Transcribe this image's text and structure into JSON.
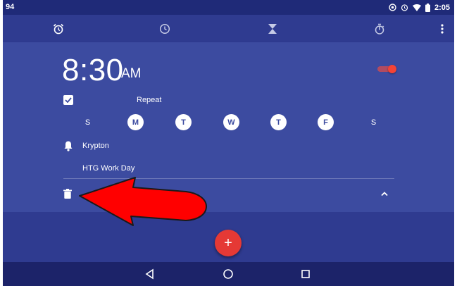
{
  "status_bar": {
    "battery_level": "94",
    "time": "2:05"
  },
  "tabs": [
    {
      "icon": "alarm-icon",
      "selected": true
    },
    {
      "icon": "clock-icon",
      "selected": false
    },
    {
      "icon": "timer-icon",
      "selected": false
    },
    {
      "icon": "stopwatch-icon",
      "selected": false
    }
  ],
  "alarm": {
    "time": "8:30",
    "ampm": "AM",
    "enabled": true,
    "repeat_checked": true,
    "repeat_label": "Repeat",
    "days": [
      {
        "letter": "S",
        "selected": false
      },
      {
        "letter": "M",
        "selected": true
      },
      {
        "letter": "T",
        "selected": true
      },
      {
        "letter": "W",
        "selected": true
      },
      {
        "letter": "T",
        "selected": true
      },
      {
        "letter": "F",
        "selected": true
      },
      {
        "letter": "S",
        "selected": false
      }
    ],
    "ringtone": "Krypton",
    "label": "HTG Work Day"
  },
  "fab": {
    "symbol": "+"
  },
  "colors": {
    "background": "#2f3b90",
    "card": "#3c4ba0",
    "accent": "#f44336",
    "annotation_arrow": "#ff0000"
  }
}
